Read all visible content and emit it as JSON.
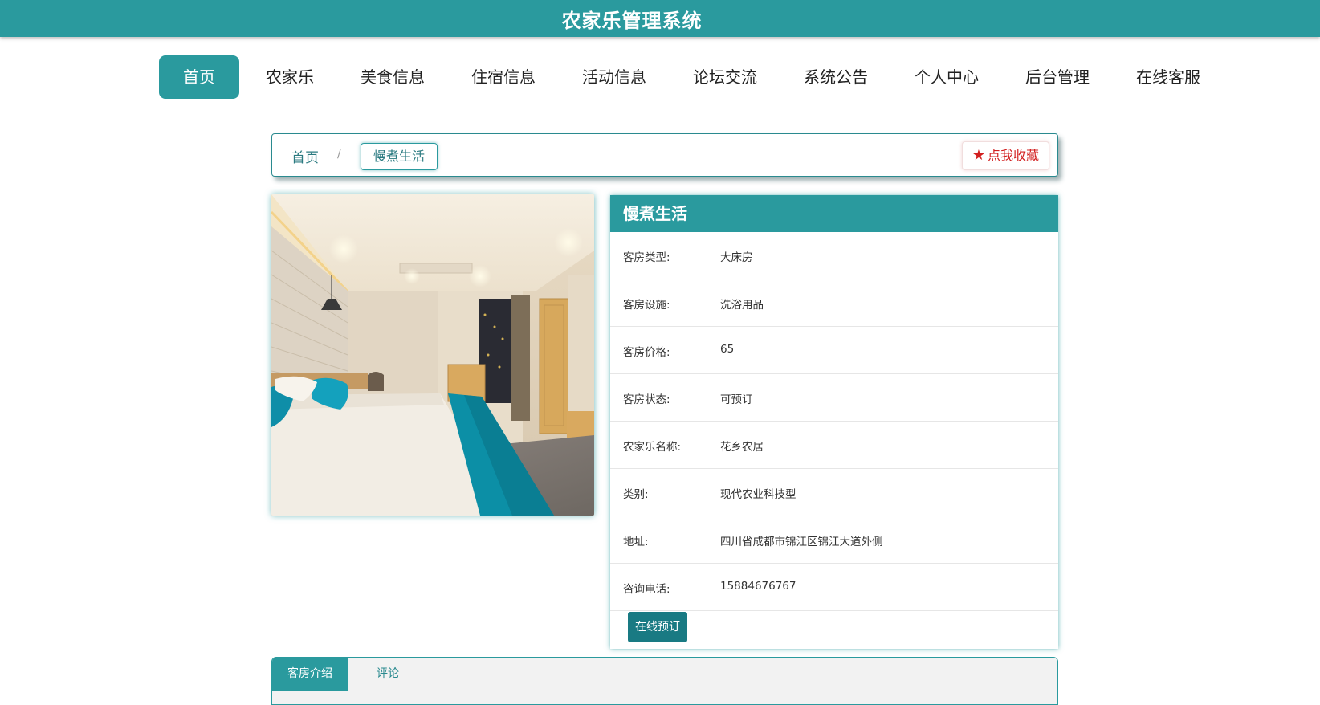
{
  "header": {
    "title": "农家乐管理系统"
  },
  "nav": {
    "items": [
      "首页",
      "农家乐",
      "美食信息",
      "住宿信息",
      "活动信息",
      "论坛交流",
      "系统公告",
      "个人中心",
      "后台管理",
      "在线客服"
    ],
    "active": "首页"
  },
  "breadcrumb": {
    "home": "首页",
    "separator": "/",
    "current": "慢煮生活"
  },
  "favorite": {
    "label": "点我收藏"
  },
  "detail": {
    "title": "慢煮生活",
    "fields": [
      {
        "label": "客房类型:",
        "value": "大床房"
      },
      {
        "label": "客房设施:",
        "value": "洗浴用品"
      },
      {
        "label": "客房价格:",
        "value": "65"
      },
      {
        "label": "客房状态:",
        "value": "可预订"
      },
      {
        "label": "农家乐名称:",
        "value": "花乡农居"
      },
      {
        "label": "类别:",
        "value": "现代农业科技型"
      },
      {
        "label": "地址:",
        "value": "四川省成都市锦江区锦江大道外侧"
      },
      {
        "label": "咨询电话:",
        "value": "15884676767"
      }
    ],
    "book_label": "在线预订"
  },
  "tabs": {
    "items": [
      "客房介绍",
      "评论"
    ]
  },
  "colors": {
    "primary": "#2a9a9e",
    "button": "#197a83",
    "favorite": "#d21f1f"
  }
}
